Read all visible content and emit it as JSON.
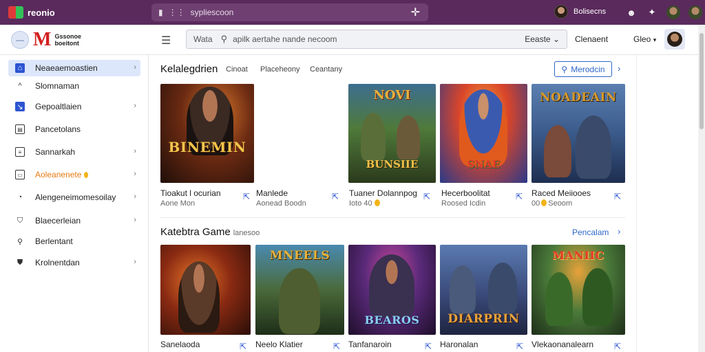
{
  "browser": {
    "app_name": "reonio",
    "tab_title": "sypliescoon",
    "user_name": "Bolisecns",
    "icons": [
      "new-tab-icon",
      "notifications-icon",
      "star-icon"
    ]
  },
  "header": {
    "brand_line1": "Gssonoe",
    "brand_line2": "boeitont",
    "search_label": "Wata",
    "search_placeholder": "apilk aertahe nande necoom",
    "search_select": "Eeaste",
    "link1": "Clenaent",
    "link2": "Gleo"
  },
  "sidebar": {
    "items": [
      {
        "label": "Neaeaemoastien",
        "icon": "home-icon",
        "active": true,
        "chevron": true
      },
      {
        "label": "Slomnaman",
        "icon": "caret-up-icon",
        "active": false,
        "chevron": false
      },
      {
        "label": "Gepoaltlaien",
        "icon": "chart-icon",
        "active": false,
        "chevron": true
      },
      {
        "label": "Pancetolans",
        "icon": "grid-icon",
        "active": false,
        "chevron": false
      },
      {
        "label": "Sannarkah",
        "icon": "list-icon",
        "active": false,
        "chevron": true
      },
      {
        "label": "Aoleanenete",
        "icon": "bookmark-icon",
        "active": false,
        "chevron": true,
        "orange": true
      },
      {
        "label": "Alengeneimomesoilay",
        "icon": "clock-icon",
        "active": false,
        "chevron": true
      },
      {
        "label": "Blaecerleian",
        "icon": "tag-icon",
        "active": false,
        "chevron": true
      },
      {
        "label": "Berlentant",
        "icon": "search-icon",
        "active": false,
        "chevron": false
      },
      {
        "label": "Krolnentdan",
        "icon": "shield-icon",
        "active": false,
        "chevron": true
      }
    ]
  },
  "section1": {
    "title": "Kelalegdrien",
    "tabs": [
      "Cinoat",
      "Placeheony",
      "Ceantany"
    ],
    "button_label": "Merodcin",
    "cards": [
      {
        "name": "Tioakut l ocurian",
        "meta": "Aone  Mon",
        "art": "BINEMIN",
        "coin": false
      },
      {
        "name": "Manlede",
        "meta": "Aonead Boodn",
        "art": "BUNSIIE",
        "coin": false
      },
      {
        "name": "Tuaner Dolannpog",
        "meta": "Ioto 40",
        "art": "SNAE",
        "coin": true
      },
      {
        "name": "Hecerboolitat",
        "meta": "Roosed Icdin",
        "art": "",
        "coin": false
      },
      {
        "name": "Raced Meiiooes",
        "meta": "00",
        "meta2": "Seoom",
        "art": "NOADEAIN",
        "coin": true
      }
    ]
  },
  "section2": {
    "title": "Katebtra Game",
    "subtitle": "lanesoo",
    "link": "Pencalam",
    "cards": [
      {
        "name": "Sanelaoda",
        "art": ""
      },
      {
        "name": "Neelo Klatier",
        "art": "MNEELS"
      },
      {
        "name": "Tanfanaroin",
        "art": "BEAROS"
      },
      {
        "name": "Haronalan",
        "art": "DIARPRIN"
      },
      {
        "name": "Vlekaonanalearn",
        "art": "MANIIC"
      }
    ]
  },
  "colors": {
    "accent": "#2d66c9",
    "topbar": "#5a2a5c",
    "brand_red": "#d32020",
    "active_bg": "#dde7fb",
    "orange": "#e47a12"
  }
}
